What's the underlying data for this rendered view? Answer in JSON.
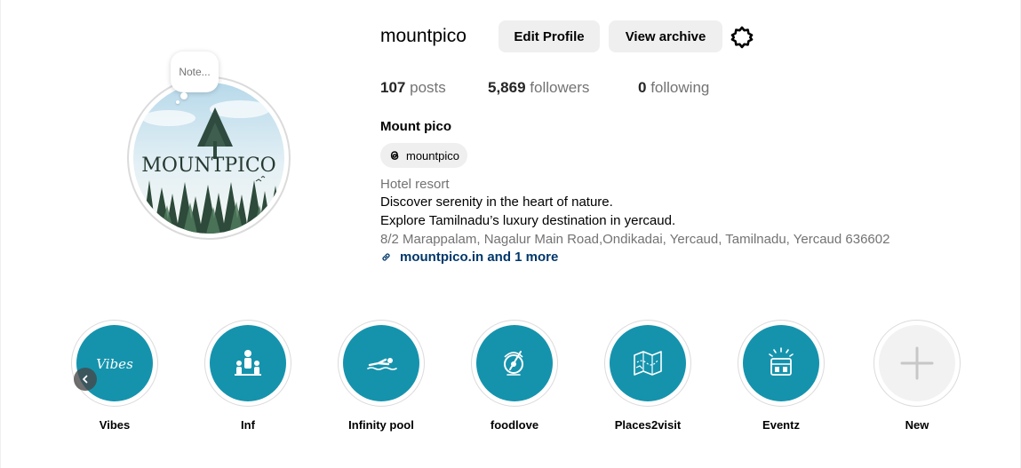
{
  "profile": {
    "username": "mountpico",
    "note_placeholder": "Note...",
    "logo_text": "MOUNTPICO",
    "full_name": "Mount pico",
    "threads_handle": "mountpico",
    "category": "Hotel resort",
    "bio_line1": "Discover serenity in the heart of nature.",
    "bio_line2": "Explore Tamilnadu’s luxury destination in yercaud.",
    "address": "8/2 Marappalam, Nagalur Main Road,Ondikadai, Yercaud, Tamilnadu, Yercaud 636602",
    "link_text": "mountpico.in and 1 more"
  },
  "actions": {
    "edit_profile": "Edit Profile",
    "view_archive": "View archive"
  },
  "stats": {
    "posts_count": "107",
    "posts_label": "posts",
    "followers_count": "5,869",
    "followers_label": "followers",
    "following_count": "0",
    "following_label": "following"
  },
  "highlights": [
    {
      "label": "Vibes",
      "icon": "vibes-script-icon"
    },
    {
      "label": "Inf",
      "icon": "people-info-icon"
    },
    {
      "label": "Infinity pool",
      "icon": "swimmer-icon"
    },
    {
      "label": "foodlove",
      "icon": "food-icon"
    },
    {
      "label": "Places2visit",
      "icon": "map-icon"
    },
    {
      "label": "Eventz",
      "icon": "celebration-icon"
    },
    {
      "label": "New",
      "icon": "plus-icon"
    }
  ],
  "highlights_vibes_icon_text": "Vibes",
  "colors": {
    "highlight_bg": "#1593ad",
    "link": "#00376b",
    "button_bg": "#efefef",
    "muted_text": "#737373"
  }
}
